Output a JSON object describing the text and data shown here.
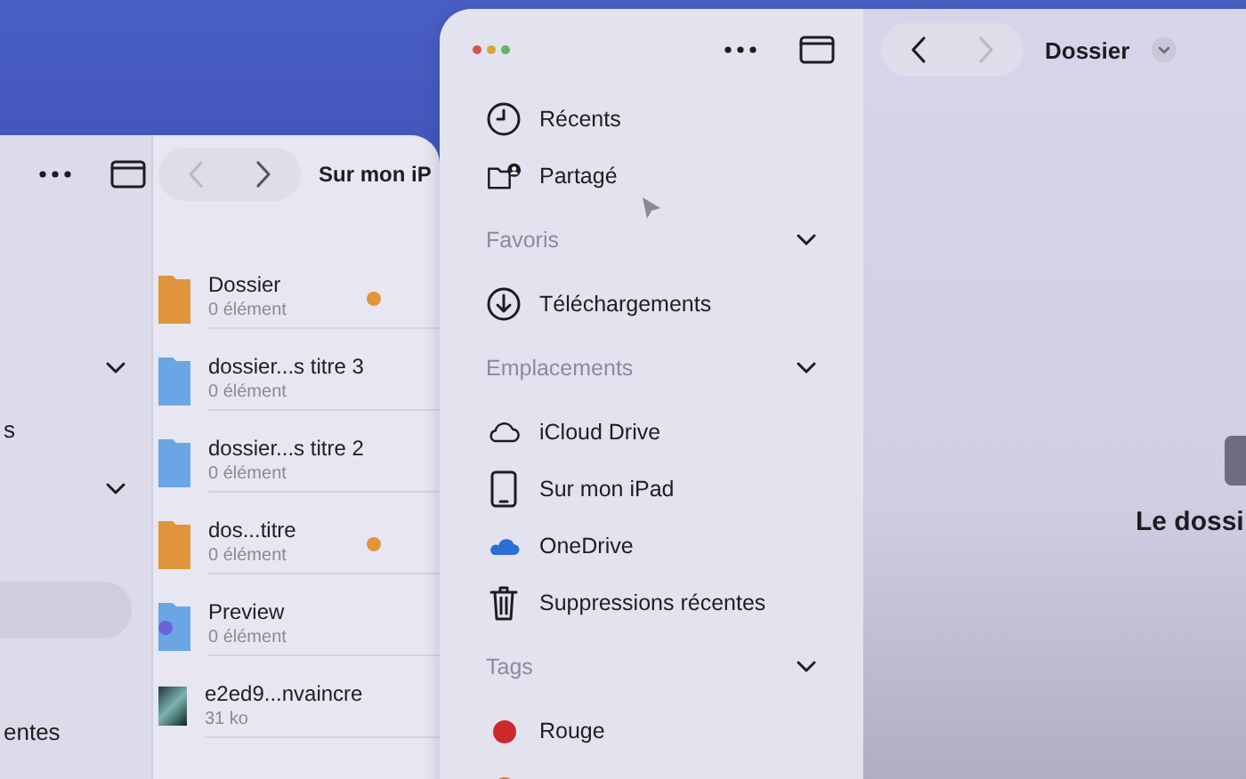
{
  "back_window": {
    "title": "Sur mon iP",
    "sidebar": {
      "rows": [
        {
          "kind": "section",
          "expanded": true
        },
        {
          "kind": "item",
          "label": "s",
          "selected": false
        },
        {
          "kind": "section",
          "expanded": true
        },
        {
          "kind": "blank"
        },
        {
          "kind": "item",
          "selected": true
        },
        {
          "kind": "blank"
        },
        {
          "kind": "item",
          "label": "entes",
          "selected": false
        }
      ]
    },
    "files": [
      {
        "kind": "folder",
        "name": "Dossier",
        "detail": "0 élément",
        "color": "#e0953a"
      },
      {
        "kind": "folder",
        "name": "dossier...s titre 3",
        "detail": "0 élément"
      },
      {
        "kind": "folder",
        "name": "dossier...s titre 2",
        "detail": "0 élément"
      },
      {
        "kind": "folder",
        "name": "dos...titre",
        "detail": "0 élément",
        "color": "#e0953a"
      },
      {
        "kind": "app-folder",
        "name": "Preview",
        "detail": "0 élément"
      },
      {
        "kind": "image",
        "name": "e2ed9...nvaincre",
        "detail": "31 ko"
      }
    ]
  },
  "front_window": {
    "sidebar": {
      "rows": [
        {
          "kind": "clock",
          "label": "Récents"
        },
        {
          "kind": "shared",
          "label": "Partagé"
        },
        {
          "kind": "section",
          "label": "Favoris",
          "expanded": true
        },
        {
          "kind": "download",
          "label": "Téléchargements"
        },
        {
          "kind": "section",
          "label": "Emplacements",
          "expanded": true
        },
        {
          "kind": "cloud",
          "label": "iCloud Drive"
        },
        {
          "kind": "tablet",
          "label": "Sur mon iPad"
        },
        {
          "kind": "onedrive",
          "label": "OneDrive"
        },
        {
          "kind": "trash",
          "label": "Suppressions récentes"
        },
        {
          "kind": "section",
          "label": "Tags",
          "expanded": true
        },
        {
          "kind": "tag",
          "label": "Rouge",
          "color": "#cc2a2a"
        },
        {
          "kind": "tag",
          "color": "#c8803a"
        }
      ]
    },
    "content": {
      "title": "Dossier",
      "empty_message": "Le dossi"
    }
  }
}
